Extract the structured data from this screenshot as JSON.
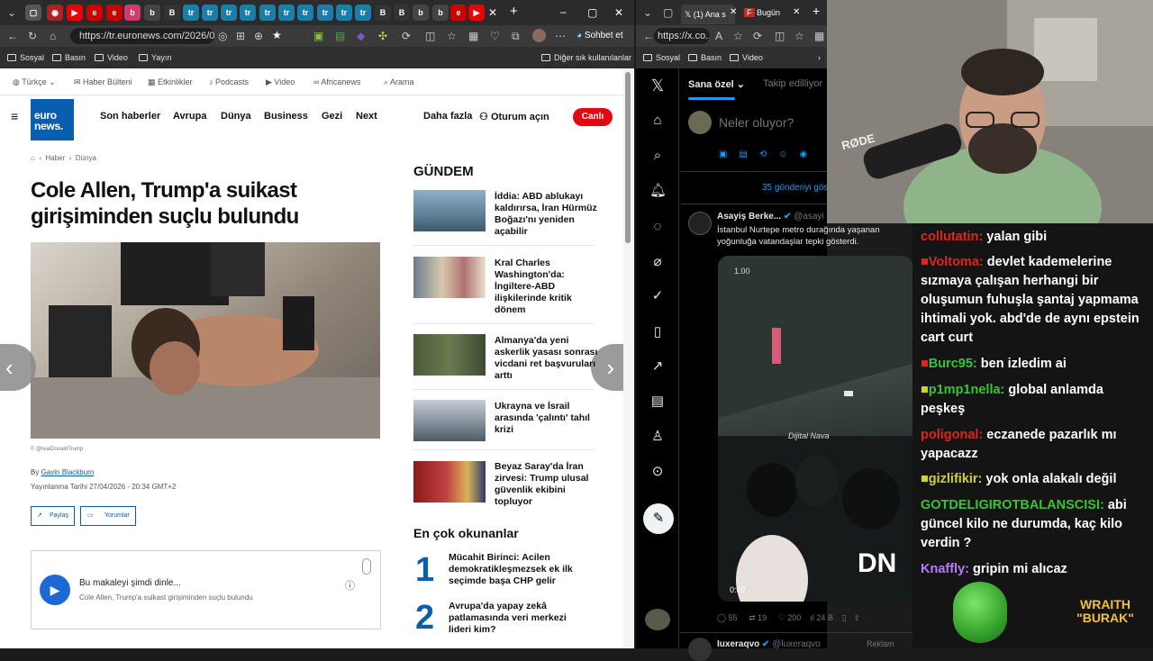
{
  "left_browser": {
    "address": "https://tr.euronews.com/2026/0...",
    "copilot_label": "Sohbet et",
    "bookmarks": [
      "Sosyal",
      "Basın",
      "Video",
      "Yayın"
    ],
    "bookmarks_right": "Diğer sık kullanılanlar"
  },
  "site": {
    "topline": [
      "Türkçe",
      "Haber Bülteni",
      "Etkinlikler",
      "Podcasts",
      "Video",
      "Africanews",
      "Arama"
    ],
    "logo_line1": "euro",
    "logo_line2": "news.",
    "nav": [
      "Son haberler",
      "Avrupa",
      "Dünya",
      "Business",
      "Gezi",
      "Next"
    ],
    "more": "Daha fazla",
    "login": "Oturum açın",
    "live": "Canlı",
    "breadcrumb": [
      "Haber",
      "Dünya"
    ],
    "headline": "Cole Allen, Trump'a suikast girişiminden suçlu bulundu",
    "photo_credit": "© @realDonaldTrump",
    "by_prefix": "By",
    "author": "Gavin Blackburn",
    "published": "Yayınlanma Tarihi 27/04/2026 - 20:34 GMT+2",
    "share": "Paylaş",
    "comments": "Yorumlar",
    "audio_title": "Bu makaleyi şimdi dinle...",
    "audio_sub": "Cole Allen, Trump'a suikast girişiminden suçlu bulundu",
    "gundem_title": "GÜNDEM",
    "gundem": [
      "İddia: ABD ablukayı kaldırırsa, İran Hürmüz Boğazı'nı yeniden açabilir",
      "Kral Charles Washington'da: İngiltere-ABD ilişkilerinde kritik dönem",
      "Almanya'da yeni askerlik yasası sonrası vicdani ret başvuruları arttı",
      "Ukrayna ve İsrail arasında 'çalıntı' tahıl krizi",
      "Beyaz Saray'da İran zirvesi: Trump ulusal güvenlik ekibini topluyor"
    ],
    "most_read_title": "En çok okunanlar",
    "most_read": [
      {
        "rank": "1",
        "title": "Mücahit Birinci: Acilen demokratikleşmezsek ek ilk seçimde başa CHP gelir"
      },
      {
        "rank": "2",
        "title": "Avrupa'da yapay zekâ patlamasında veri merkezi lideri kim?"
      }
    ]
  },
  "right_browser": {
    "tab1": "(1) Ana s",
    "tab2": "Bugün",
    "address": "https://x.co...",
    "bookmarks": [
      "Sosyal",
      "Basın",
      "Video"
    ],
    "feed_tabs": [
      "Sana özel",
      "Takip edilliyor"
    ],
    "compose_placeholder": "Neler oluyor?",
    "new_posts": "35 gönderiyi gös",
    "post_author": "Asayiş Berke...",
    "post_handle": "@asayi",
    "post_text": "İstanbul Nurtepe metro durağında yaşanan yoğunluğa vatandaşlar tepki gösterdi.",
    "video_speed": "1.00",
    "video_time": "0:02",
    "watermark": "Dijital Nava",
    "stats": {
      "replies": "55",
      "reposts": "19",
      "likes": "200",
      "views": "24 B"
    },
    "next_author": "Iuxeraqvo",
    "next_handle": "@luxeraqvo",
    "ad_label": "Reklam"
  },
  "stream": {
    "mic_brand": "RØDE",
    "chat": [
      {
        "user": "collutatin:",
        "text": " yalan gibi",
        "color": "#e0261b"
      },
      {
        "user": "Voltoma:",
        "text": " devlet kademelerine sızmaya çalışan herhangi bir oluşumun fuhuşla şantaj yapmama ihtimali yok. abd'de de aynı epstein cart curt",
        "color": "#e0261b"
      },
      {
        "user": "Burc95:",
        "text": " ben izledim ai",
        "color": "#37c437"
      },
      {
        "user": "p1mp1nella:",
        "text": " global anlamda peşkeş",
        "color": "#37c437"
      },
      {
        "user": "poligonal:",
        "text": " eczanede pazarlık mı yapacazz",
        "color": "#e0261b"
      },
      {
        "user": "gizlifikir:",
        "text": " yok onla alakalı değil",
        "color": "#d0d23a"
      },
      {
        "user": "GOTDELIGIROTBALANSCISI:",
        "text": " abi güncel kilo ne durumda, kaç kilo verdin ?",
        "color": "#37c437"
      },
      {
        "user": "Knaffly:",
        "text": " gripin mi alıcaz",
        "color": "#b77bff"
      }
    ],
    "logo_line1": "WRAITH",
    "logo_line2": "\"BURAK\""
  }
}
